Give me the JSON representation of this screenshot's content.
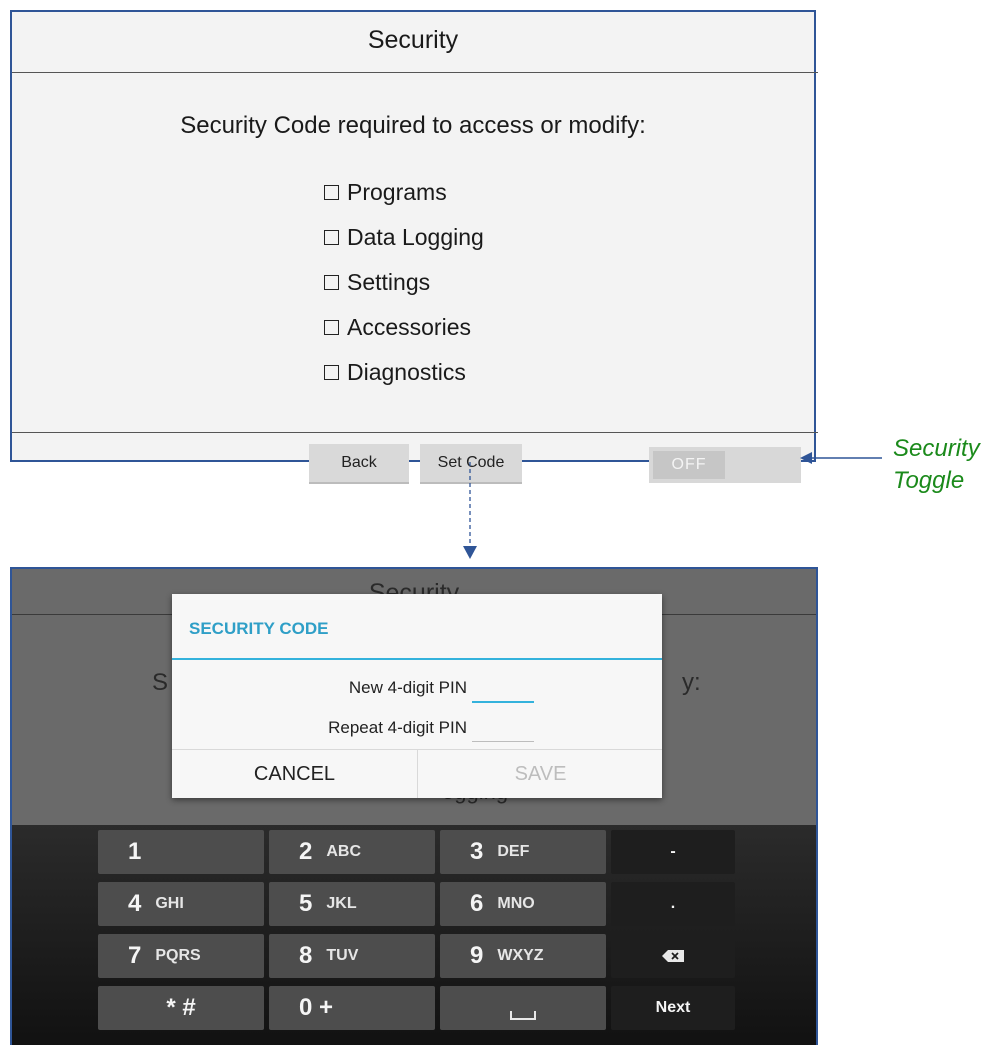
{
  "screen1": {
    "title": "Security",
    "heading": "Security Code required to access or modify:",
    "checkboxes": [
      {
        "label": "Programs",
        "checked": false
      },
      {
        "label": "Data Logging",
        "checked": false
      },
      {
        "label": "Settings",
        "checked": false
      },
      {
        "label": "Accessories",
        "checked": false
      },
      {
        "label": "Diagnostics",
        "checked": false
      }
    ],
    "buttons": {
      "back": "Back",
      "set_code": "Set Code"
    },
    "toggle": {
      "label": "OFF",
      "state": "off"
    }
  },
  "annotation": {
    "line1": "Security",
    "line2": "Toggle",
    "color": "#1b8a1b"
  },
  "screen2": {
    "background": {
      "title": "Security",
      "heading_left": "S",
      "heading_right": "y:",
      "fragment": "ogging"
    },
    "dialog": {
      "title": "SECURITY CODE",
      "new_pin_label": "New 4-digit PIN",
      "repeat_pin_label": "Repeat 4-digit PIN",
      "new_pin_value": "",
      "repeat_pin_value": "",
      "cancel": "CANCEL",
      "save": "SAVE"
    },
    "keyboard": {
      "rows": [
        [
          {
            "num": "1",
            "sub": ""
          },
          {
            "num": "2",
            "sub": "ABC"
          },
          {
            "num": "3",
            "sub": "DEF"
          },
          {
            "num": "-",
            "sub": ""
          }
        ],
        [
          {
            "num": "4",
            "sub": "GHI"
          },
          {
            "num": "5",
            "sub": "JKL"
          },
          {
            "num": "6",
            "sub": "MNO"
          },
          {
            "num": ".",
            "sub": ""
          }
        ],
        [
          {
            "num": "7",
            "sub": "PQRS"
          },
          {
            "num": "8",
            "sub": "TUV"
          },
          {
            "num": "9",
            "sub": "WXYZ"
          },
          {
            "num": "",
            "sub": "backspace-icon"
          }
        ],
        [
          {
            "num": "* #",
            "sub": ""
          },
          {
            "num": "0 +",
            "sub": ""
          },
          {
            "num": "",
            "sub": "space-icon"
          },
          {
            "num": "Next",
            "sub": ""
          }
        ]
      ]
    }
  },
  "colors": {
    "frame": "#2f5597",
    "accent": "#34b2dc",
    "dialog_title": "#2f9fc7"
  }
}
